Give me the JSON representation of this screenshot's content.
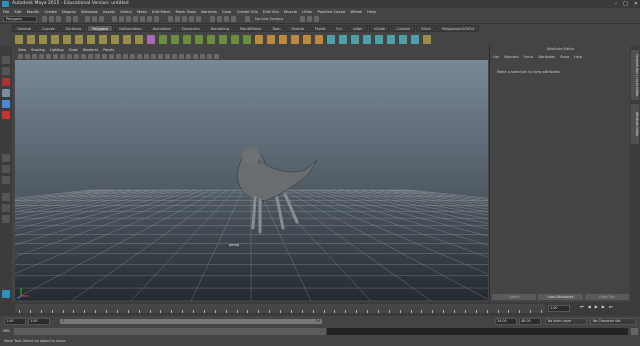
{
  "window": {
    "title": "Autodesk Maya 2015 - Educational Version: untitled",
    "controls": [
      "–",
      "□",
      "✕"
    ]
  },
  "menubar": [
    "File",
    "Edit",
    "Modify",
    "Create",
    "Display",
    "Windows",
    "Assets",
    "Select",
    "Mesh",
    "Edit Mesh",
    "Mesh Tools",
    "Normals",
    "Color",
    "Create UVs",
    "Edit UVs",
    "Muscle",
    "UGen",
    "Pipeline Cache",
    "Wheel",
    "Help"
  ],
  "statusline": {
    "mode": "Polygons",
    "live_surface": "No Live Surface"
  },
  "shelf": {
    "tabs": [
      "General",
      "Curves",
      "Surfaces",
      "Polygons",
      "Deformation",
      "Animation",
      "Dynamics",
      "Rendering",
      "PaintEffects",
      "Toon",
      "Muscle",
      "Fluids",
      "Fur",
      "nHair",
      "nCloth",
      "Custom",
      "XGen",
      "Polygonsun07404"
    ],
    "active_tab": "Polygons"
  },
  "panel": {
    "menu": [
      "View",
      "Shading",
      "Lighting",
      "Show",
      "Renderer",
      "Panels"
    ],
    "camera_label": "persp"
  },
  "attribute_editor": {
    "title": "Attribute Editor",
    "menu": [
      "List",
      "Selected",
      "Focus",
      "Attributes",
      "Show",
      "Help"
    ],
    "message": "Make a selection to view attributes",
    "buttons": [
      "Select",
      "Load Attributes",
      "Copy Tab"
    ]
  },
  "side_tabs": [
    "Channel Box / Layer Editor",
    "Attribute Editor"
  ],
  "timeslider": {
    "ticks": [
      "1",
      "",
      "",
      "",
      "",
      "",
      "",
      "",
      "",
      "",
      "",
      "",
      "",
      "",
      "",
      "",
      "",
      "",
      "",
      "",
      "",
      "",
      "",
      "",
      "",
      "",
      "",
      "",
      "",
      "",
      "",
      "",
      "",
      "",
      "",
      "",
      "",
      "",
      "",
      "",
      "",
      "",
      "",
      "",
      "",
      "",
      "",
      "",
      "24"
    ],
    "current_frame": "1.00"
  },
  "range": {
    "start": "1.00",
    "inner_start": "1.00",
    "current": "1",
    "inner_end": "24",
    "end": "24.00",
    "anim_end": "48.00",
    "anim_layer": "No Anim Layer",
    "character": "No Character Set"
  },
  "cmdline": {
    "label": "MEL"
  },
  "helpline": {
    "text": "Move Tool: Select an object to move."
  }
}
